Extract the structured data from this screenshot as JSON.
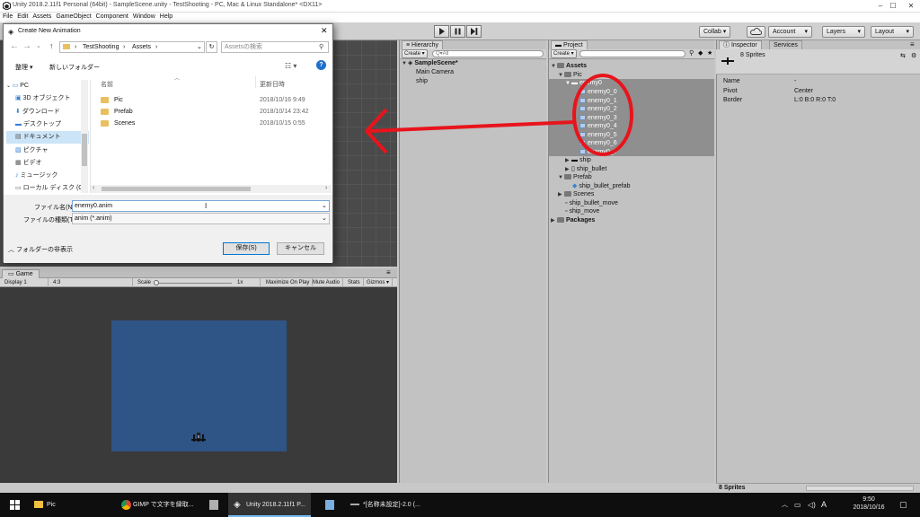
{
  "window": {
    "title": "Unity 2018.2.11f1 Personal (64bit) - SampleScene.unity - TestShooting - PC, Mac & Linux Standalone* <DX11>",
    "minimize": "–",
    "maximize": "☐",
    "close": "✕"
  },
  "menu": [
    "File",
    "Edit",
    "Assets",
    "GameObject",
    "Component",
    "Window",
    "Help"
  ],
  "toolbar": {
    "collab": "Collab ▾",
    "account": "Account",
    "layers": "Layers",
    "layout": "Layout"
  },
  "hierarchy": {
    "tab": "Hierarchy",
    "create": "Create ▾",
    "search_placeholder": "Q▾All",
    "scene": "SampleScene*",
    "items": [
      "Main Camera",
      "ship"
    ]
  },
  "project": {
    "tab": "Project",
    "create": "Create ▾",
    "tree": {
      "assets": "Assets",
      "pic": "Pic",
      "enemy_parent": "enemy0",
      "enemy_frames": [
        "enemy0_0",
        "enemy0_1",
        "enemy0_2",
        "enemy0_3",
        "enemy0_4",
        "enemy0_5",
        "enemy0_6",
        "enemy0_7"
      ],
      "ship": "ship",
      "ship_bullet": "ship_bullet",
      "prefab": "Prefab",
      "ship_bullet_prefab": "ship_bullet_prefab",
      "scenes": "Scenes",
      "ship_bullet_move": "ship_bullet_move",
      "ship_move": "ship_move",
      "packages": "Packages"
    }
  },
  "inspector": {
    "tab": "Inspector",
    "services_tab": "Services",
    "header": "8 Sprites",
    "props": [
      {
        "label": "Name",
        "value": "-"
      },
      {
        "label": "Pivot",
        "value": "Center"
      },
      {
        "label": "Border",
        "value": "L:0 B:0 R:0 T:0"
      }
    ],
    "status": "8 Sprites"
  },
  "game": {
    "tab": "Game",
    "display": "Display 1",
    "aspect": "4:3",
    "scale_label": "Scale",
    "scale_value": "1x",
    "toggles": [
      "Maximize On Play",
      "Mute Audio",
      "Stats",
      "Gizmos ▾"
    ]
  },
  "dialog": {
    "title": "Create New Animation",
    "breadcrumb": [
      "TestShooting",
      "Assets"
    ],
    "search_placeholder": "Assetsの検索",
    "organize": "整理 ▾",
    "new_folder": "新しいフォルダー",
    "nav": [
      "PC",
      "3D オブジェクト",
      "ダウンロード",
      "デスクトップ",
      "ドキュメント",
      "ピクチャ",
      "ビデオ",
      "ミュージック",
      "ローカル ディスク (C"
    ],
    "columns": {
      "name": "名前",
      "date": "更新日時"
    },
    "files": [
      {
        "name": "Pic",
        "date": "2018/10/16 9:49"
      },
      {
        "name": "Prefab",
        "date": "2018/10/14 23:42"
      },
      {
        "name": "Scenes",
        "date": "2018/10/15 0:55"
      }
    ],
    "filename_label": "ファイル名(N):",
    "filename_value": "enemy0.anim",
    "filetype_label": "ファイルの種類(T):",
    "filetype_value": "anim (*.anim)",
    "hide_folders": "フォルダーの非表示",
    "save": "保存(S)",
    "cancel": "キャンセル"
  },
  "taskbar": {
    "items": [
      "Pic",
      "GIMP で文字を縁取...",
      "Unity 2018.2.11f1 P...",
      "*[名称未設定]-2.0 (..."
    ],
    "time": "9:50",
    "date": "2018/10/16",
    "ime": "A"
  },
  "colors": {
    "annotation_red": "#e8141c",
    "game_canvas": "#2f5486",
    "selection_blue": "#cce4f7"
  }
}
